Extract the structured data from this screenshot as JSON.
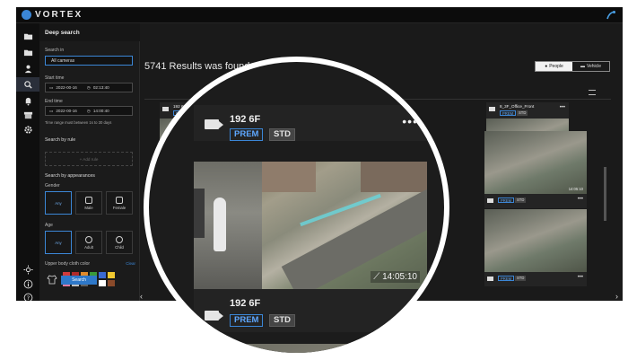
{
  "app": {
    "brand": "VORTEX"
  },
  "sidebar_icons": [
    "folder-icon",
    "folder-open-icon",
    "person-icon",
    "deep-search-icon",
    "bell-icon",
    "archive-icon",
    "gear-icon",
    "brightness-icon",
    "info-icon",
    "help-icon"
  ],
  "panel": {
    "title": "Deep search",
    "search_in_label": "Search in",
    "search_in_value": "All cameras",
    "start_time_label": "Start time",
    "start_date": "2022-00-16",
    "start_time": "02:13:40",
    "end_time_label": "End time",
    "end_date": "2022-00-16",
    "end_time": "14:00:40",
    "time_note": "Time range must between 1s to 30 days",
    "search_by_rule_label": "Search by rule",
    "add_rule_label": "+ Add rule",
    "search_by_appearances_label": "Search by appearances",
    "gender_label": "Gender",
    "gender_options": [
      "Any",
      "Male",
      "Female"
    ],
    "age_label": "Age",
    "age_options": [
      "Any",
      "Adult",
      "Child"
    ],
    "upper_body_label": "Upper body cloth color",
    "clear_label": "Clear",
    "swatch_colors": [
      "#d23a3a",
      "#b02a2a",
      "#e08a2a",
      "#3a9a3a",
      "#3a6ad2",
      "#f0c830",
      "#e07aa0",
      "#c0c0c0",
      "#606060",
      "#1a1a1a",
      "#ffffff",
      "#8a4a2a"
    ],
    "search_button": "Search"
  },
  "main": {
    "results_title": "5741 Results was found",
    "toggle_people": "People",
    "toggle_vehicle": "Vehicle",
    "accent": "#3b86d6"
  },
  "cards": [
    {
      "name": "192 6F",
      "prem": "PREM",
      "std": "STD",
      "time": ""
    },
    {
      "name": "8_3F_Office_Front",
      "prem": "PREM",
      "std": "STD",
      "time": ""
    },
    {
      "name": "",
      "prem": "PREM",
      "std": "STD",
      "time": "14:05:10"
    },
    {
      "name": "",
      "prem": "PREM",
      "std": "STD",
      "time": ""
    }
  ],
  "magnifier": {
    "top_card": {
      "name": "192 6F",
      "prem": "PREM",
      "std": "STD"
    },
    "bottom_card": {
      "name": "192 6F",
      "prem": "PREM",
      "std": "STD"
    },
    "timestamp": "14:05:10"
  }
}
